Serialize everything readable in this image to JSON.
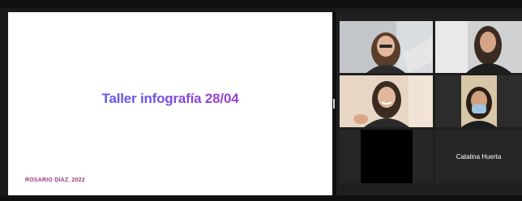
{
  "meeting": {
    "shared_slide": {
      "title": "Taller infografía 28/04",
      "credit": "ROSARIO DIAZ_2022"
    },
    "participants": [
      {
        "role": "active-speaker",
        "video": "on"
      },
      {
        "video": "on"
      },
      {
        "video": "on"
      },
      {
        "video": "on"
      },
      {
        "video": "off"
      },
      {
        "name": "Catalina Huerta",
        "video": "off"
      }
    ]
  },
  "colors": {
    "title_gradient": [
      "#3a68ff",
      "#7a4ce0",
      "#d12ca8"
    ],
    "credit": "#9c3a86",
    "active_speaker_border": "#2fa84f",
    "gallery_background": "#1f1f1f"
  }
}
